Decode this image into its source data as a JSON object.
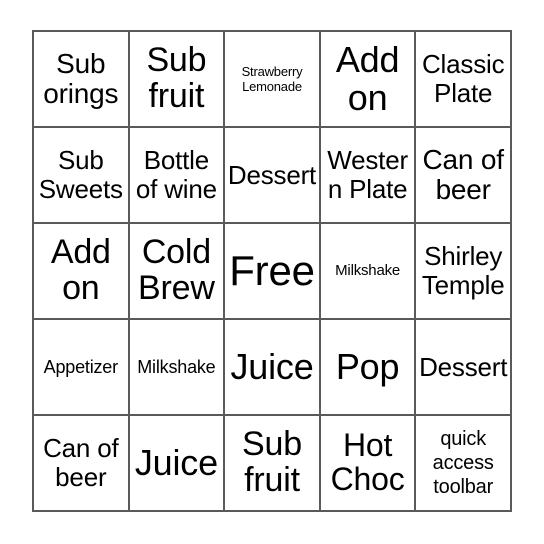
{
  "card": {
    "type": "bingo-card",
    "rows": 5,
    "columns": 5,
    "free_space_label": "Free",
    "free_space_position": {
      "row": 3,
      "column": 3
    },
    "border_color": "#5a5a5a",
    "background_color": "#ffffff",
    "text_color": "#000000",
    "cells": [
      {
        "text": "Sub orings",
        "size": "ml"
      },
      {
        "text": "Sub fruit",
        "size": "xl"
      },
      {
        "text": "Strawberry Lemonade",
        "size": "xxs"
      },
      {
        "text": "Add on",
        "size": "xxl"
      },
      {
        "text": "Classic Plate",
        "size": "m"
      },
      {
        "text": "Sub Sweets",
        "size": "m"
      },
      {
        "text": "Bottle of wine",
        "size": "m"
      },
      {
        "text": "Dessert",
        "size": "m"
      },
      {
        "text": "Western Plate",
        "size": "m"
      },
      {
        "text": "Can of beer",
        "size": "ml"
      },
      {
        "text": "Add on",
        "size": "xl"
      },
      {
        "text": "Cold Brew",
        "size": "xl"
      },
      {
        "text": "Free",
        "size": "huge"
      },
      {
        "text": "Milkshake",
        "size": "xs"
      },
      {
        "text": "Shirley Temple",
        "size": "m"
      },
      {
        "text": "Appetizer",
        "size": "s"
      },
      {
        "text": "Milkshake",
        "size": "s"
      },
      {
        "text": "Juice",
        "size": "xxl"
      },
      {
        "text": "Pop",
        "size": "xxl"
      },
      {
        "text": "Dessert",
        "size": "m"
      },
      {
        "text": "Can of beer",
        "size": "m"
      },
      {
        "text": "Juice",
        "size": "xxl"
      },
      {
        "text": "Sub fruit",
        "size": "xl"
      },
      {
        "text": "Hot Choc",
        "size": "l"
      },
      {
        "text": "quick access toolbar",
        "size": "sm"
      }
    ]
  }
}
